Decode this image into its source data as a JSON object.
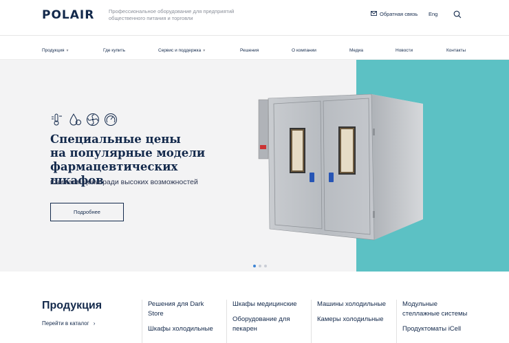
{
  "header": {
    "logo": "POLAIR",
    "tagline": "Профессиональное оборудование для предприятий общественного питания и торговли",
    "feedback": "Обратная связь",
    "lang": "Eng"
  },
  "nav": {
    "items": [
      "Продукция",
      "Где купить",
      "Сервис и поддержка",
      "Решения",
      "О компании",
      "Медиа",
      "Новости",
      "Контакты"
    ]
  },
  "hero": {
    "title_line1": "Специальные цены",
    "title_line2": "на популярные модели",
    "title_line3": "фармацевтических шкафов",
    "subtitle": "Снижаем цены ради высоких возможностей",
    "button": "Подробнее",
    "slides": 3,
    "active_slide": 1
  },
  "products": {
    "title": "Продукция",
    "catalog_link": "Перейти в каталог",
    "columns": [
      [
        "Решения для Dark Store",
        "Шкафы холодильные"
      ],
      [
        "Шкафы медицинские",
        "Оборудование для пекарен"
      ],
      [
        "Машины холодильные",
        "Камеры холодильные"
      ],
      [
        "Модульные стеллажные системы",
        "Продуктоматы iCell"
      ]
    ]
  },
  "colors": {
    "brand": "#13294b",
    "accent_teal": "#5cc1c4",
    "dot_active": "#3c83d4"
  }
}
